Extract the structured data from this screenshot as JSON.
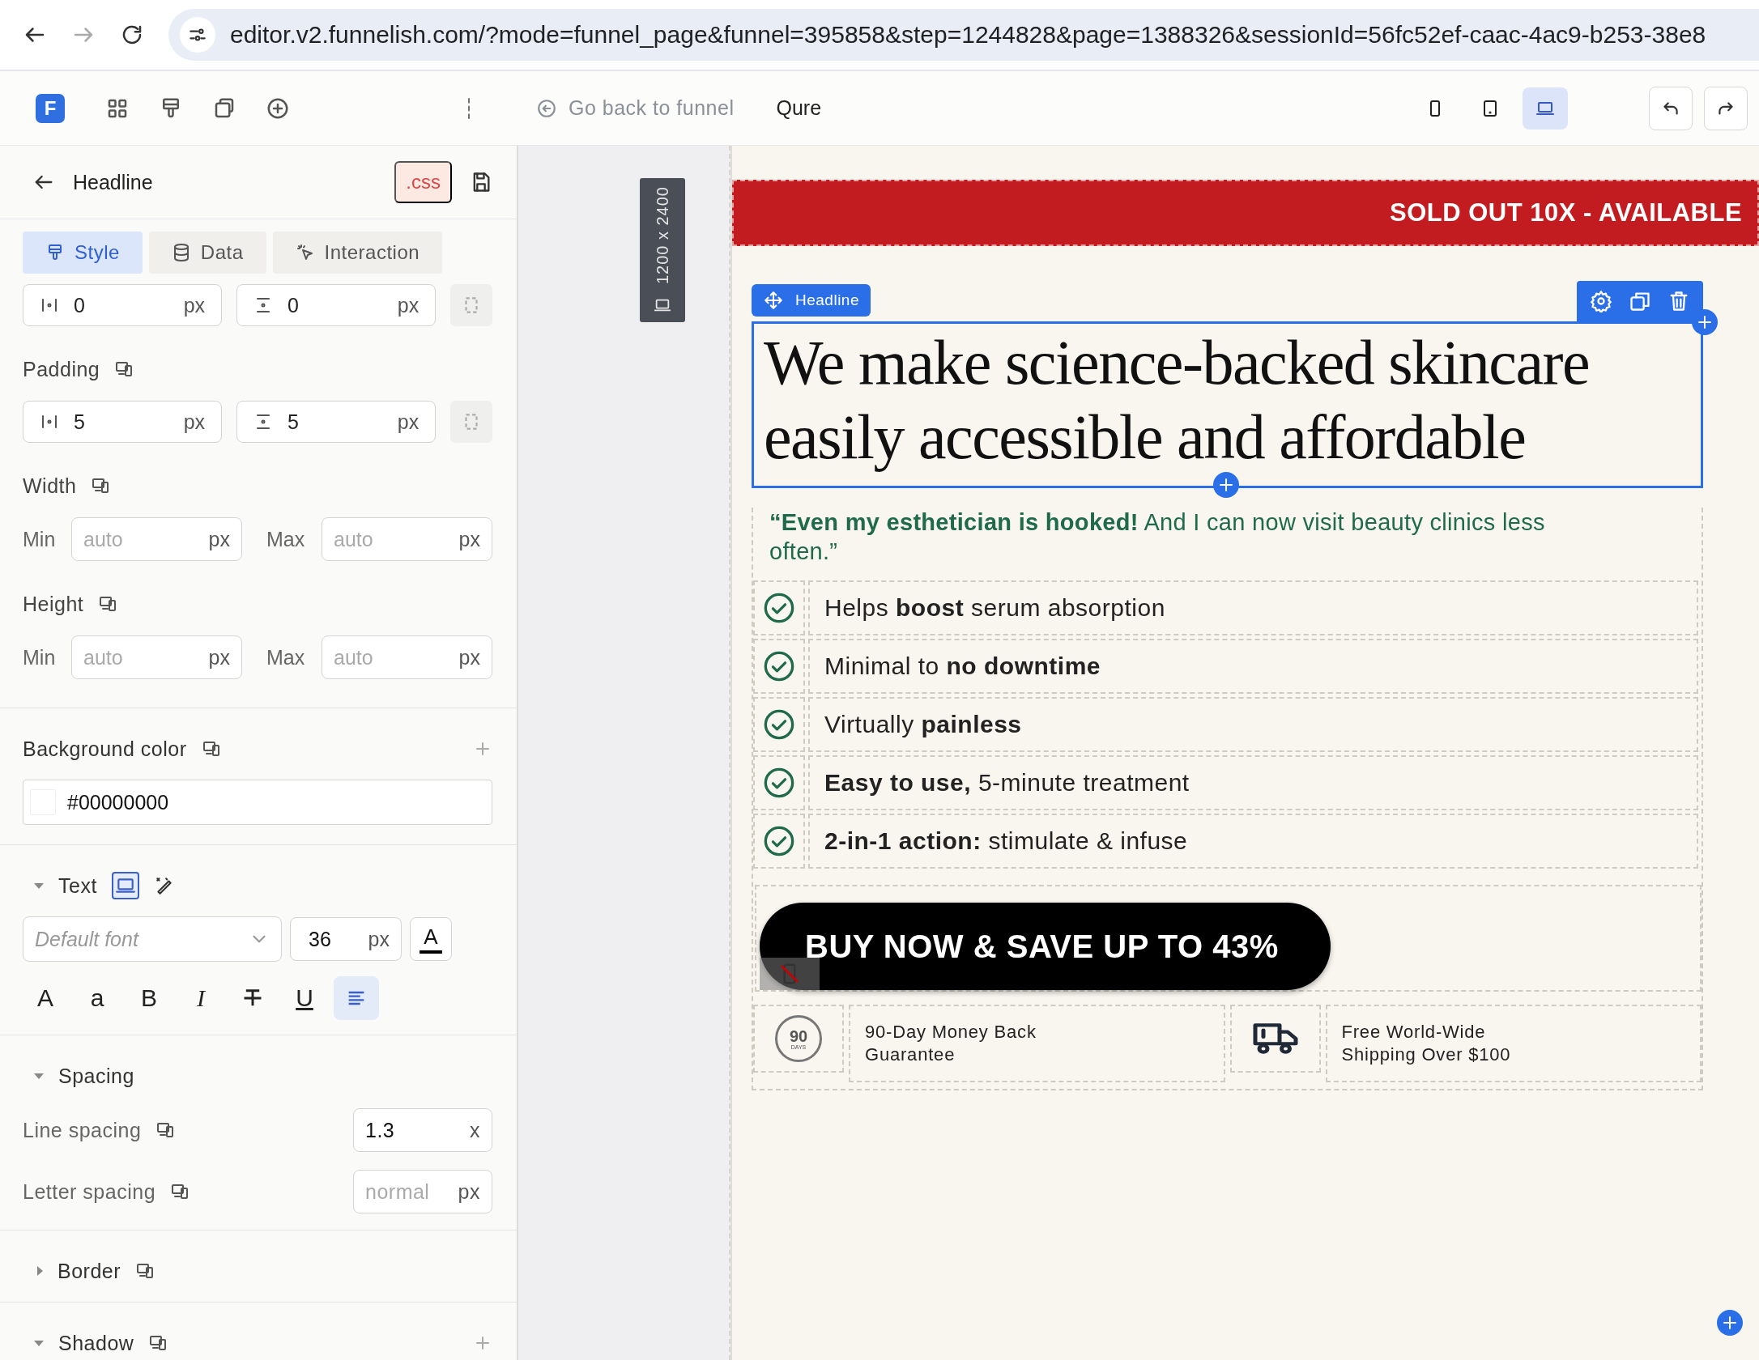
{
  "browser": {
    "url": "editor.v2.funnelish.com/?mode=funnel_page&funnel=395858&step=1244828&page=1388326&sessionId=56fc52ef-caac-4ac9-b253-38e8"
  },
  "toolbar": {
    "logo": "F",
    "back_link": "Go back to funnel",
    "page_name": "Qure",
    "devices": [
      {
        "kind": "phone",
        "selected": false
      },
      {
        "kind": "tablet",
        "selected": false
      },
      {
        "kind": "desktop",
        "selected": true
      }
    ]
  },
  "panel": {
    "title": "Headline",
    "css_badge": ".css",
    "tabs": [
      {
        "kind": "style",
        "label": "Style",
        "selected": true
      },
      {
        "kind": "data",
        "label": "Data",
        "selected": false
      },
      {
        "kind": "interaction",
        "label": "Interaction",
        "selected": false
      }
    ],
    "margin": [
      {
        "kind": "horizontal",
        "value": "0",
        "unit": "px"
      },
      {
        "kind": "vertical",
        "value": "0",
        "unit": "px"
      }
    ],
    "padding": {
      "label": "Padding",
      "fields": [
        {
          "kind": "horizontal",
          "value": "5",
          "unit": "px"
        },
        {
          "kind": "vertical",
          "value": "5",
          "unit": "px"
        }
      ]
    },
    "width": {
      "label": "Width",
      "min": {
        "label": "Min",
        "placeholder": "auto",
        "unit": "px"
      },
      "max": {
        "label": "Max",
        "placeholder": "auto",
        "unit": "px"
      }
    },
    "height": {
      "label": "Height",
      "min": {
        "label": "Min",
        "placeholder": "auto",
        "unit": "px"
      },
      "max": {
        "label": "Max",
        "placeholder": "auto",
        "unit": "px"
      }
    },
    "background": {
      "label": "Background color",
      "value": "#00000000"
    },
    "text": {
      "label": "Text",
      "expanded": true,
      "font_placeholder": "Default font",
      "size": "36",
      "unit": "px",
      "color_label": "A",
      "formats": [
        {
          "kind": "uppercase",
          "label": "A",
          "selected": false
        },
        {
          "kind": "lowercase",
          "label": "a",
          "selected": false
        },
        {
          "kind": "bold",
          "label": "B",
          "selected": false
        },
        {
          "kind": "italic",
          "label": "I",
          "selected": false
        },
        {
          "kind": "strike",
          "selected": false
        },
        {
          "kind": "underline",
          "label": "U",
          "selected": false
        },
        {
          "kind": "align-left",
          "selected": true
        }
      ]
    },
    "spacing": {
      "label": "Spacing",
      "expanded": true,
      "line_label": "Line spacing",
      "line_value": "1.3",
      "line_unit": "x",
      "letter_label": "Letter spacing",
      "letter_placeholder": "normal",
      "letter_unit": "px"
    },
    "sections": [
      {
        "label": "Border",
        "expanded": false,
        "addable": false
      },
      {
        "label": "Shadow",
        "expanded": true,
        "addable": true
      }
    ]
  },
  "canvas": {
    "size_badge": "1200 x 2400",
    "banner": "SOLD OUT 10X - AVAILABLE",
    "element_chip": "Headline",
    "headline": "We make science-backed skincare easily accessible and affordable",
    "quote": "**“Even my esthetician is hooked!** And I can now visit beauty clinics less often.”",
    "features": [
      "Helps **boost** serum absorption",
      "Minimal to **no downtime**",
      "Virtually **painless**",
      "**Easy to use,** 5-minute treatment",
      "**2-in-1 action:** stimulate & infuse"
    ],
    "cta": "BUY NOW & SAVE UP TO 43%",
    "guarantees": [
      {
        "kind": "days",
        "badge": "90",
        "badge_sub": "DAYS",
        "text": "90-Day Money Back Guarantee"
      },
      {
        "kind": "truck",
        "text": "Free World-Wide Shipping Over $100"
      }
    ]
  }
}
